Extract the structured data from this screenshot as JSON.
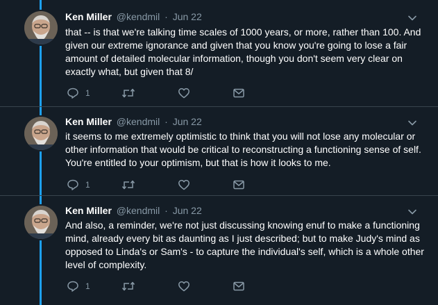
{
  "tweets": [
    {
      "name": "Ken Miller",
      "handle": "@kendmil",
      "separator": "·",
      "date": "Jun 22",
      "text": "that -- is that we're talking time scales of 1000 years, or more, rather than 100. And given our extreme ignorance and given that you know you're going to lose a fair amount of detailed molecular information, though you don't seem very clear on exactly what, but given that 8/",
      "reply_count": "1",
      "icons": [
        "reply-icon",
        "retweet-icon",
        "like-icon",
        "message-icon",
        "chevron-down-icon"
      ]
    },
    {
      "name": "Ken Miller",
      "handle": "@kendmil",
      "separator": "·",
      "date": "Jun 22",
      "text": "it seems to me extremely optimistic to think that you will not lose any molecular or other information that would be critical to reconstructing a functioning sense of self. You're entitled to your optimism, but that is how it looks to me.",
      "reply_count": "1",
      "icons": [
        "reply-icon",
        "retweet-icon",
        "like-icon",
        "message-icon",
        "chevron-down-icon"
      ]
    },
    {
      "name": "Ken Miller",
      "handle": "@kendmil",
      "separator": "·",
      "date": "Jun 22",
      "text": "And also, a reminder, we're not just discussing knowing enuf to make a functioning mind, already every bit as daunting as I just described; but to make Judy's mind as opposed to Linda's or Sam's - to capture the individual's self, which is a whole other level of complexity.",
      "reply_count": "1",
      "icons": [
        "reply-icon",
        "retweet-icon",
        "like-icon",
        "message-icon",
        "chevron-down-icon"
      ]
    }
  ],
  "colors": {
    "background": "#141d26",
    "thread_line": "#1da1f2",
    "primary_text": "#ffffff",
    "secondary_text": "#8899a6",
    "divider": "#38444d"
  }
}
